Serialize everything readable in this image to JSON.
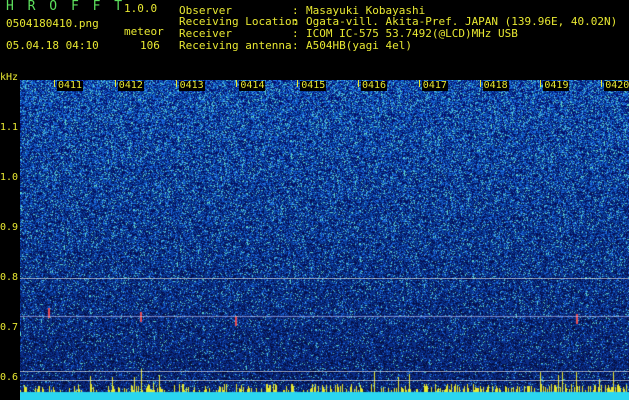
{
  "header": {
    "app_title": "H R O F F T",
    "version": "1.0.0",
    "filename": "0504180410.png",
    "datetime": "05.04.18 04:10",
    "detector": "meteor",
    "count": "106"
  },
  "meta": [
    {
      "label": "Observer",
      "value": "Masayuki Kobayashi"
    },
    {
      "label": "Receiving Location",
      "value": "Ogata-vill. Akita-Pref. JAPAN (139.96E, 40.02N)"
    },
    {
      "label": "Receiver",
      "value": "ICOM IC-575 53.7492(@LCD)MHz USB"
    },
    {
      "label": "Receiving antenna",
      "value": "A504HB(yagi 4el)"
    }
  ],
  "axis": {
    "y_unit": "kHz",
    "y_ticks": [
      "1.1",
      "1.0",
      "0.9",
      "0.8",
      "0.7",
      "0.6"
    ],
    "x_ticks": [
      "0411",
      "0412",
      "0413",
      "0414",
      "0415",
      "0416",
      "0417",
      "0418",
      "0419",
      "0420"
    ]
  },
  "colors": {
    "label": "#e8e832",
    "title": "#5de05d",
    "background": "#000000"
  }
}
